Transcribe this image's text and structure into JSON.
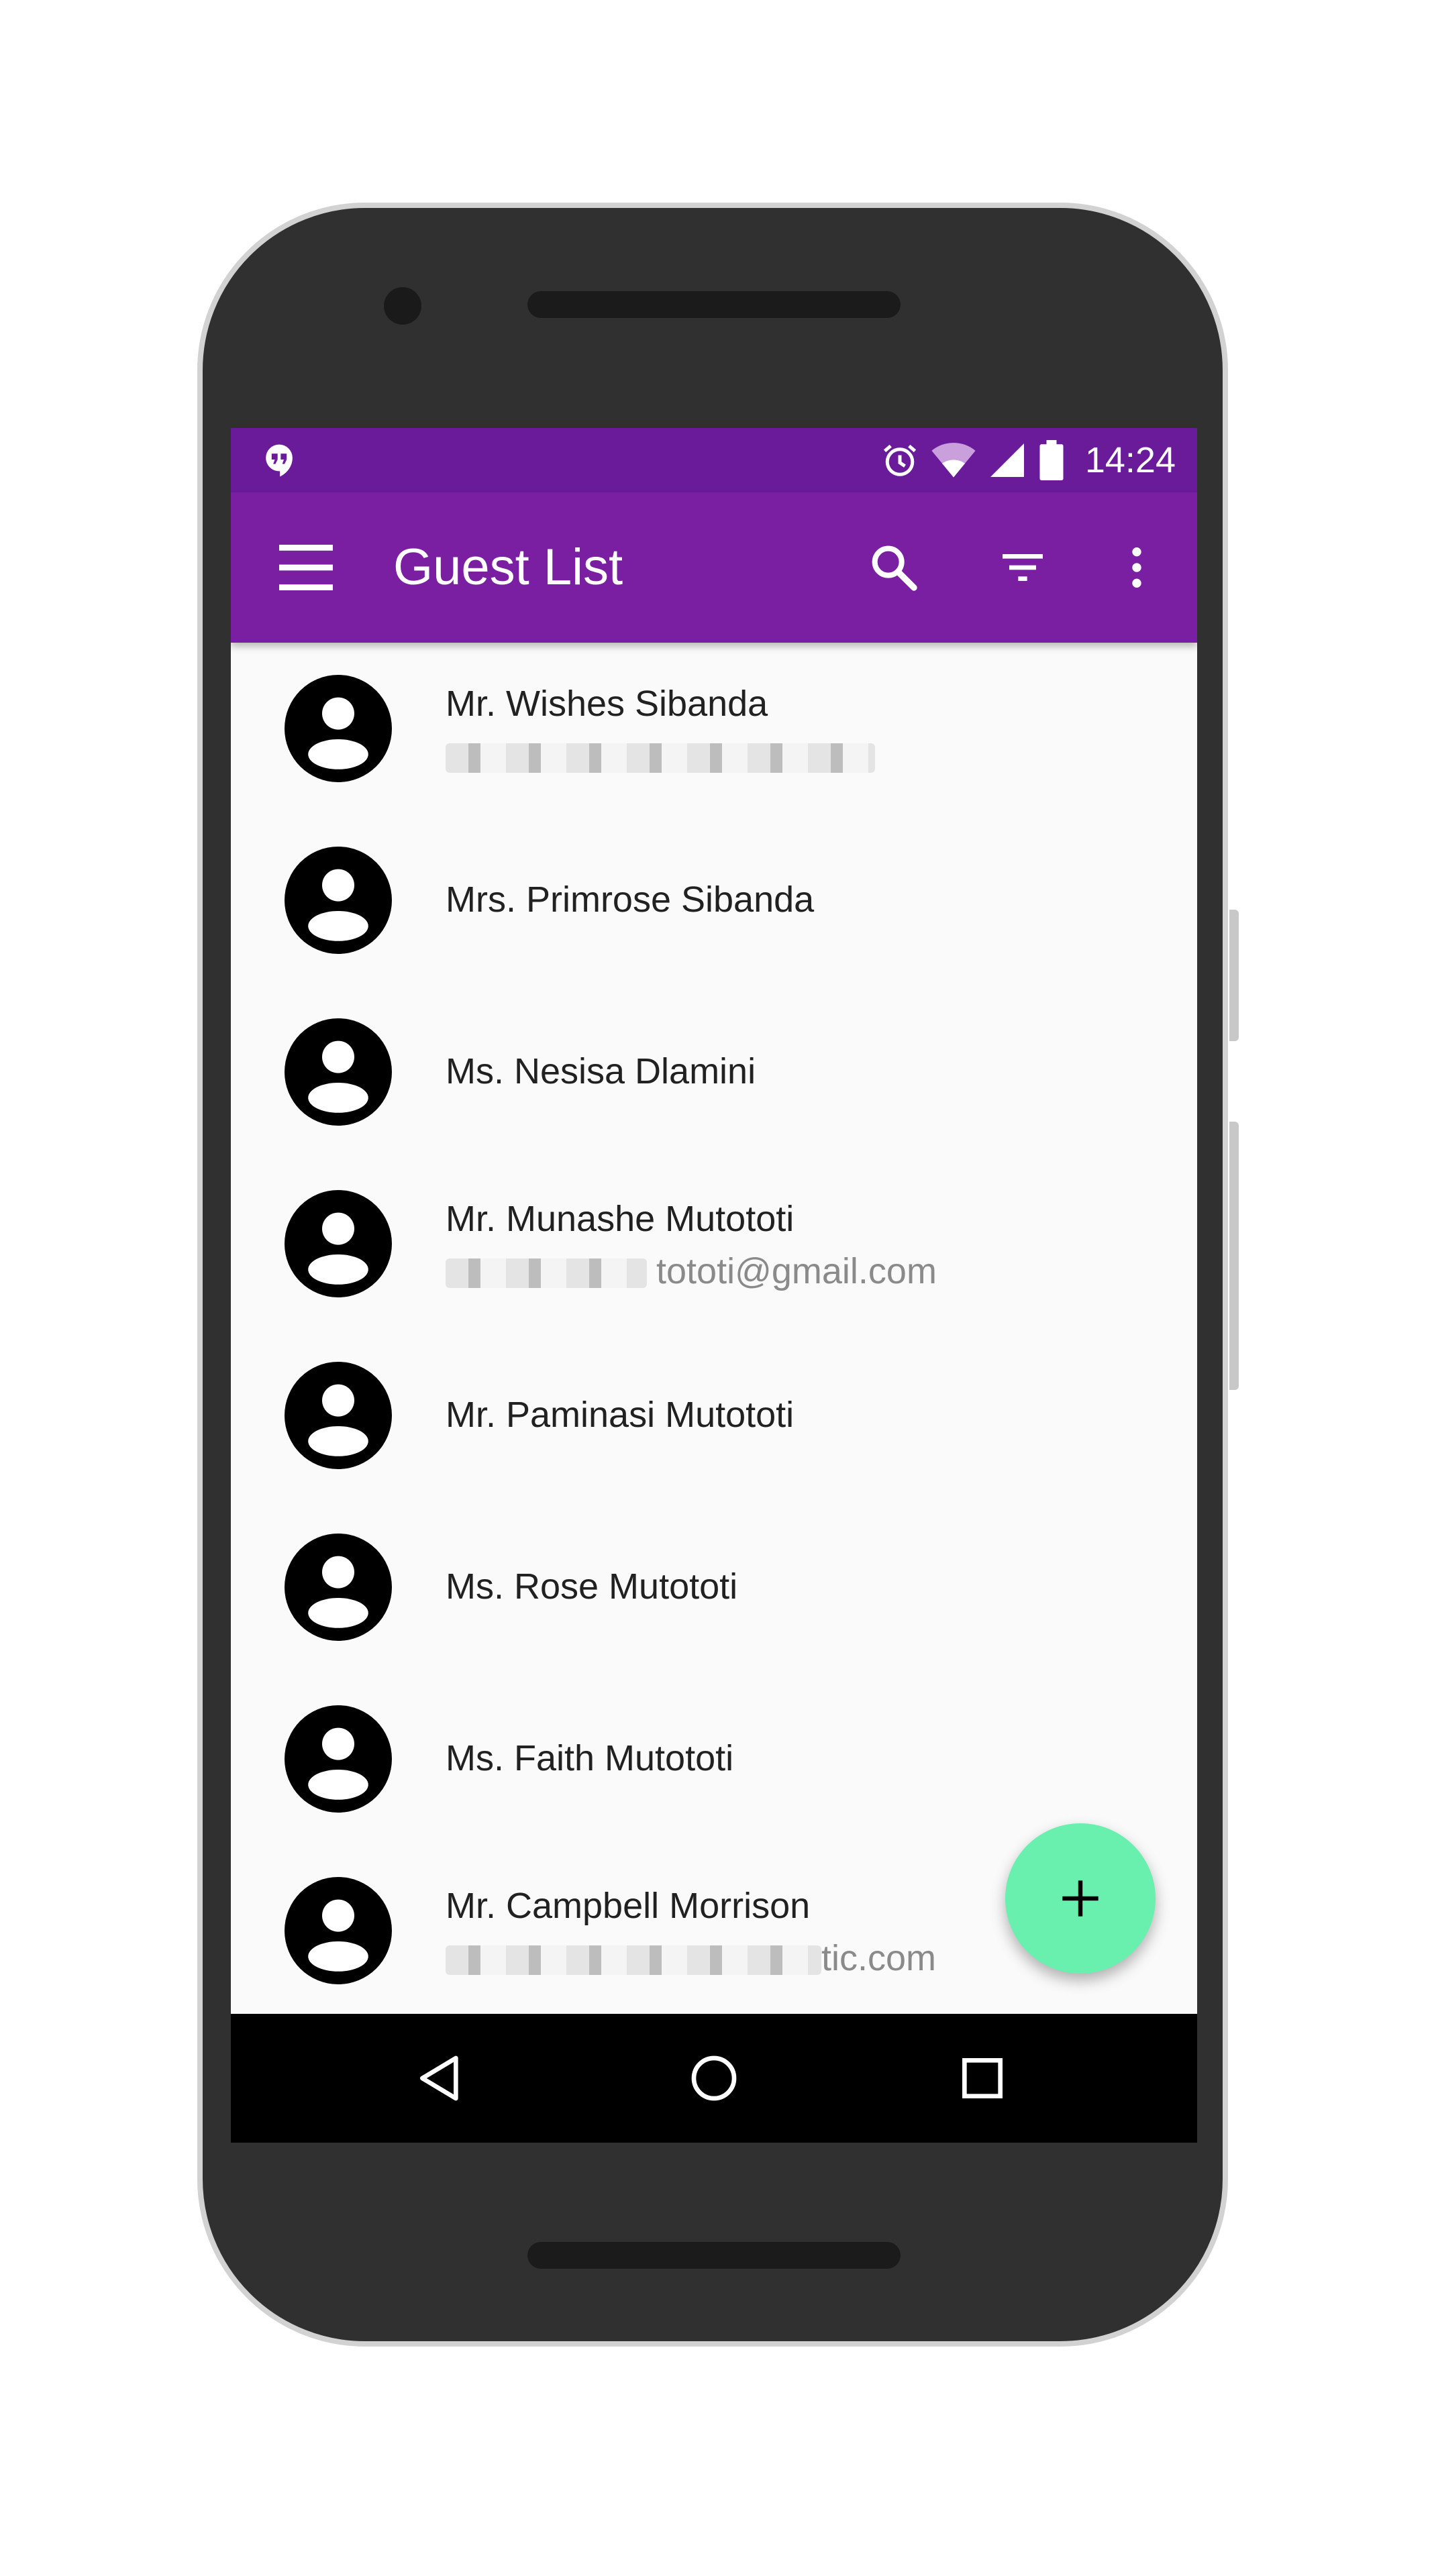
{
  "status_bar": {
    "time": "14:24"
  },
  "toolbar": {
    "title": "Guest List"
  },
  "guests": [
    {
      "name": "Mr. Wishes  Sibanda",
      "email": ""
    },
    {
      "name": "Mrs. Primrose Sibanda"
    },
    {
      "name": "Ms. Nesisa Dlamini"
    },
    {
      "name": "Mr. Munashe Mutototi",
      "email": "tototi@gmail.com"
    },
    {
      "name": "Mr. Paminasi Mutototi"
    },
    {
      "name": "Ms. Rose Mutototi"
    },
    {
      "name": "Ms. Faith Mutototi"
    },
    {
      "name": "Mr. Campbell Morrison",
      "email": "tic.com"
    }
  ],
  "colors": {
    "status_bar": "#6a1b9a",
    "app_bar": "#7b1fa2",
    "fab": "#69f0ae",
    "list_bg": "#fafafa"
  },
  "icons": [
    "hangouts-icon",
    "alarm-icon",
    "wifi-icon",
    "signal-icon",
    "battery-icon",
    "menu-icon",
    "search-icon",
    "filter-icon",
    "more-vert-icon",
    "account-circle-icon",
    "add-icon",
    "back-icon",
    "home-icon",
    "recents-icon"
  ]
}
